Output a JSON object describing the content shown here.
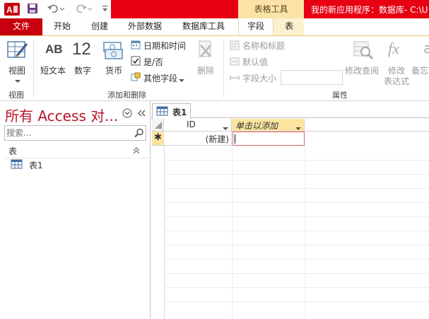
{
  "titlebar": {
    "context_group": "表格工具",
    "app_title": "我的新应用程序：数据库- C:\\U"
  },
  "tabs": [
    "文件",
    "开始",
    "创建",
    "外部数据",
    "数据库工具",
    "字段",
    "表"
  ],
  "ribbon": {
    "view": {
      "label": "视图",
      "group": "视图"
    },
    "add_delete": {
      "group": "添加和删除",
      "ab_glyph": "AB",
      "short_text": "短文本",
      "num_glyph": "12",
      "number": "数字",
      "currency": "货币",
      "datetime": "日期和时间",
      "yesno": "是/否",
      "more_fields": "其他字段",
      "delete": "删除"
    },
    "properties": {
      "group": "属性",
      "name_caption": "名称和标题",
      "default_value": "默认值",
      "field_size": "字段大小",
      "field_size_value": "",
      "modify_lookups": "修改查阅",
      "fx_glyph": "fx",
      "modify_expression_1": "修改",
      "modify_expression_2": "表达式",
      "memo_1": "备忘",
      "memo_glyph": "a"
    }
  },
  "nav": {
    "title": "所有 Access 对...",
    "search_placeholder": "搜索...",
    "section": "表",
    "items": [
      "表1"
    ]
  },
  "document": {
    "tab": "表1",
    "columns": [
      "ID",
      "单击以添加"
    ],
    "new_row_marker": "✱",
    "new_row_id": "(新建)"
  },
  "colors": {
    "title_red": "#e60012",
    "file_tab": "#c8000e",
    "context_yellow": "#fbe3a7",
    "accent_red": "#b7152a",
    "header_yellow": "#fce4a0"
  }
}
